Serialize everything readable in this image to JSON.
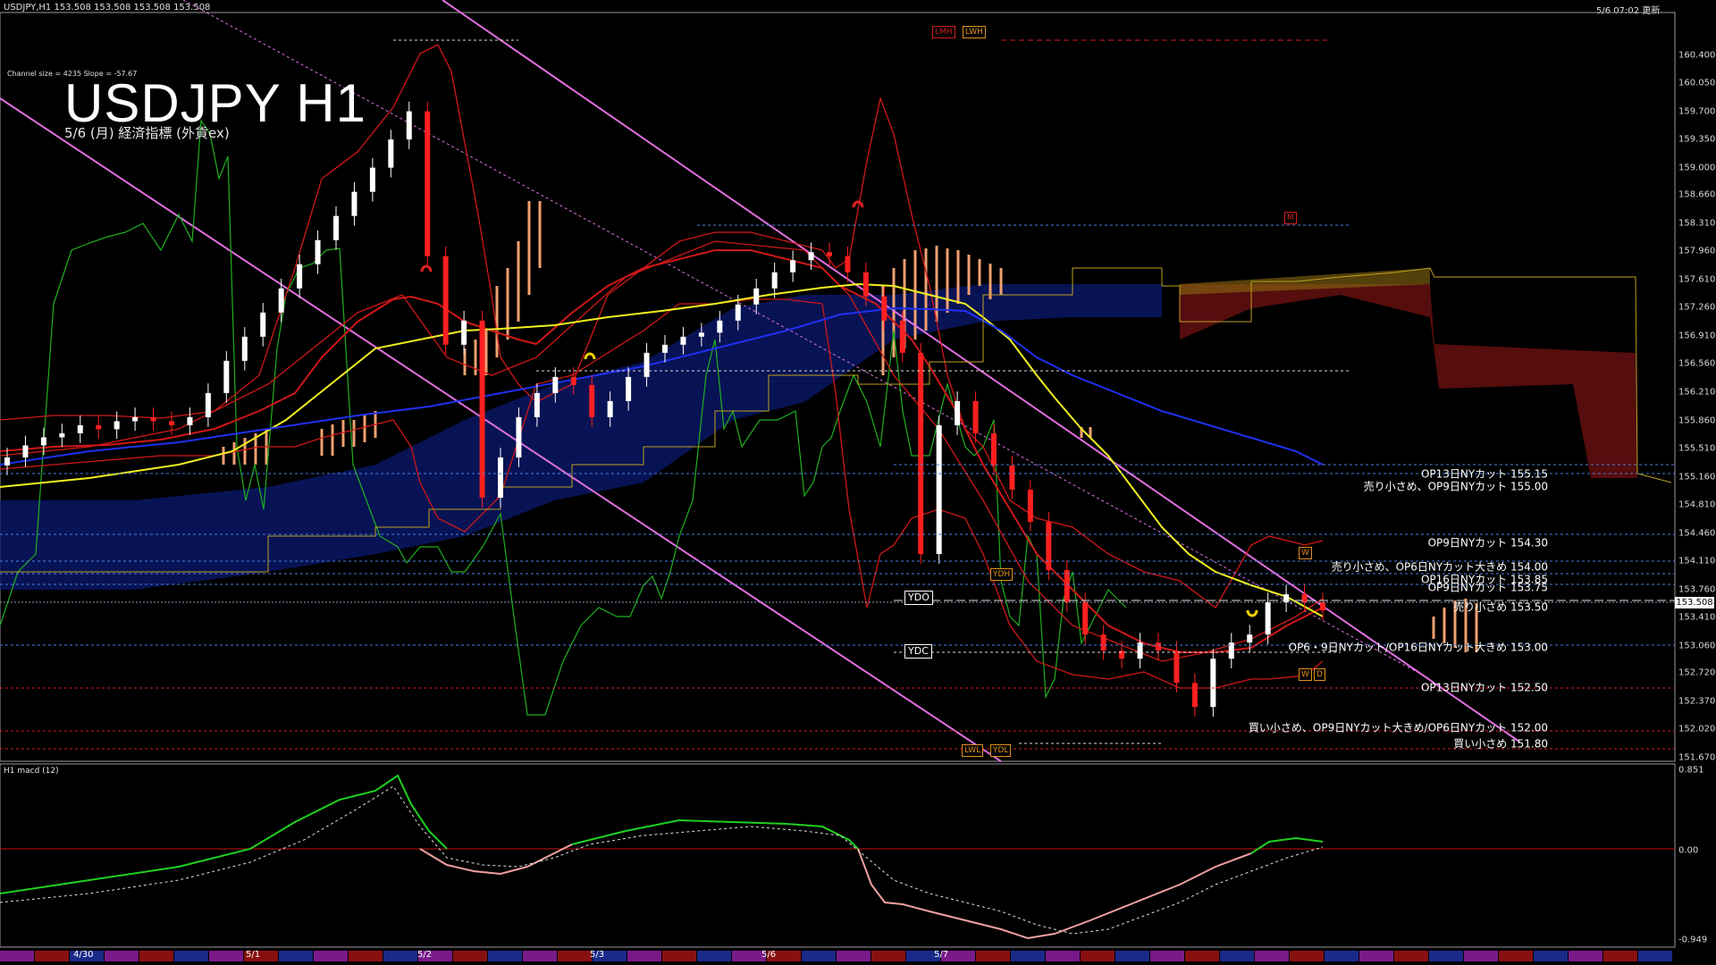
{
  "header": {
    "symbol_line": "USDJPY,H1  153.508 153.508 153.508 153.508",
    "updated": "5/6 07:02 更新",
    "channel_info": "Channel size = 4235 Slope = -57.67"
  },
  "title": "USDJPY H1",
  "subtitle": "5/6 (月) 経済指標 (外貨ex)",
  "macd_label": "H1  macd (12)",
  "current_price": "153.508",
  "chart_data": {
    "type": "candlestick",
    "symbol": "USDJPY",
    "timeframe": "H1",
    "ylim": [
      151.67,
      160.45
    ],
    "y_ticks": [
      "160.400",
      "160.050",
      "159.700",
      "159.350",
      "159.000",
      "158.660",
      "158.310",
      "157.960",
      "157.610",
      "157.260",
      "156.910",
      "156.560",
      "156.210",
      "155.860",
      "155.510",
      "155.160",
      "154.810",
      "154.460",
      "154.110",
      "153.760",
      "153.410",
      "153.060",
      "152.720",
      "152.370",
      "152.020",
      "151.670"
    ],
    "x_labels": [
      "4/30",
      "5/1",
      "5/2",
      "5/3",
      "5/6",
      "5/7"
    ],
    "closes": [
      155.4,
      155.55,
      155.65,
      155.7,
      155.8,
      155.75,
      155.85,
      155.9,
      155.85,
      155.8,
      155.9,
      156.2,
      156.6,
      156.9,
      157.2,
      157.5,
      157.8,
      158.1,
      158.4,
      158.7,
      159.0,
      159.35,
      159.7,
      157.9,
      156.8,
      157.1,
      154.9,
      155.4,
      155.9,
      156.2,
      156.4,
      156.3,
      155.9,
      156.1,
      156.4,
      156.7,
      156.8,
      156.9,
      156.95,
      157.1,
      157.3,
      157.5,
      157.7,
      157.85,
      157.95,
      157.9,
      157.7,
      157.4,
      157.1,
      156.7,
      154.2,
      155.8,
      156.1,
      155.7,
      155.3,
      155.0,
      154.6,
      154.0,
      153.6,
      153.2,
      153.0,
      152.9,
      153.1,
      153.0,
      152.6,
      152.3,
      152.9,
      153.1,
      153.2,
      153.6,
      153.7,
      153.6,
      153.5
    ],
    "macd": {
      "ylim": [
        -0.949,
        0.851
      ],
      "y_ticks": [
        "0.851",
        "0.00",
        "-0.949"
      ],
      "values": [
        0.3,
        0.35,
        0.4,
        0.45,
        0.5,
        0.55,
        0.6,
        0.65,
        0.75,
        0.85,
        0.4,
        0.1,
        -0.15,
        -0.2,
        -0.05,
        0.15,
        0.25,
        0.35,
        0.45,
        0.5,
        0.5,
        0.48,
        0.45,
        0.4,
        0.1,
        -0.45,
        -0.6,
        -0.62,
        -0.7,
        -0.85,
        -0.8,
        -0.7,
        -0.55,
        -0.4,
        -0.3,
        -0.15,
        0.05,
        0.18,
        0.2
      ]
    },
    "levels": [
      {
        "label": "OP13日NYカット 155.15",
        "value": 155.15
      },
      {
        "label": "売り小さめ、OP9日NYカット 155.00",
        "value": 155.0
      },
      {
        "label": "OP9日NYカット 154.30",
        "value": 154.3
      },
      {
        "label": "売り小さめ、OP6日NYカット大きめ 154.00",
        "value": 154.0
      },
      {
        "label": "OP16日NYカット 153.85",
        "value": 153.85
      },
      {
        "label": "OP9日NYカット 153.75",
        "value": 153.75
      },
      {
        "label": "売り小さめ 153.50",
        "value": 153.5
      },
      {
        "label": "OP6・9日NYカット/OP16日NYカット大きめ 153.00",
        "value": 153.0
      },
      {
        "label": "OP13日NYカット 152.50",
        "value": 152.5
      },
      {
        "label": "買い小さめ、OP9日NYカット大きめ/OP6日NYカット 152.00",
        "value": 152.0
      },
      {
        "label": "買い小さめ 151.80",
        "value": 151.8
      }
    ],
    "markers": {
      "ydo": "YDO",
      "ydc": "YDC",
      "ydh": "YDH",
      "ydl": "YDL",
      "lwh": "LWH",
      "lwl": "LWL",
      "lmh": "LMH",
      "m": "M",
      "w": "W",
      "d": "D"
    }
  }
}
